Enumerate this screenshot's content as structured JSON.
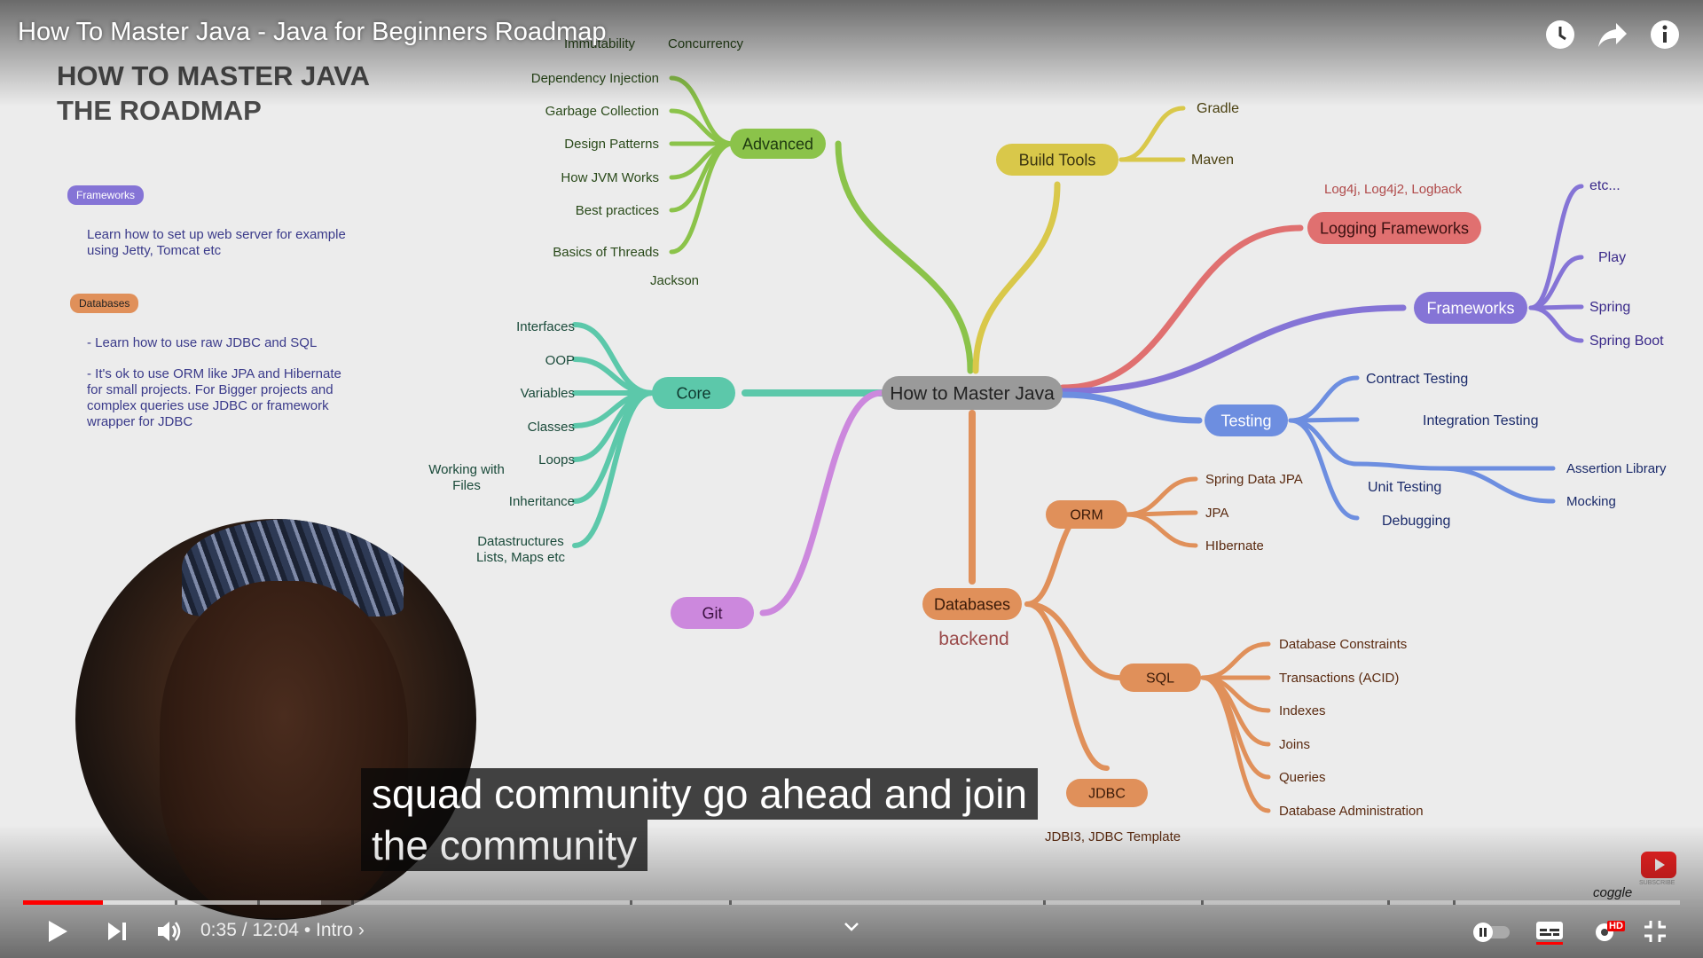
{
  "video": {
    "title": "How To Master Java - Java for Beginners Roadmap",
    "time_current": "0:35",
    "time_separator": "/",
    "time_total": "12:04",
    "chapter": "• Intro ›",
    "progress_played": 0.048,
    "progress_loaded": 0.18,
    "captions": [
      "squad community go ahead and join",
      "the community"
    ],
    "watermark": "coggle",
    "subscribe_label": "SUBSCRIBE"
  },
  "top_controls": {
    "watch_later_icon": "clock-icon",
    "share_icon": "share-icon",
    "info_icon": "info-icon"
  },
  "slide": {
    "heading_line1": "HOW TO MASTER JAVA",
    "heading_line2": "THE ROADMAP",
    "badge_frameworks": "Frameworks",
    "note_frameworks": [
      "Learn how to set up web server for example",
      "using Jetty, Tomcat etc"
    ],
    "badge_databases": "Databases",
    "note_db_1": "- Learn how to use raw JDBC and SQL",
    "note_db_2": [
      "- It's ok to use ORM like JPA and Hibernate",
      "for small projects. For Bigger projects and",
      "complex queries use JDBC or framework",
      "wrapper for JDBC"
    ]
  },
  "mindmap": {
    "center": "How to Master Java",
    "advanced": {
      "label": "Advanced",
      "items": [
        "Dependency Injection",
        "Garbage Collection",
        "Design Patterns",
        "How JVM Works",
        "Best practices",
        "Basics of Threads"
      ],
      "extra": [
        "Immutability",
        "Concurrency",
        "Jackson"
      ]
    },
    "build_tools": {
      "label": "Build Tools",
      "items": [
        "Gradle",
        "Maven"
      ]
    },
    "logging": {
      "label": "Logging Frameworks",
      "note": "Log4j, Log4j2, Logback"
    },
    "frameworks": {
      "label": "Frameworks",
      "items": [
        "etc...",
        "Play",
        "Spring",
        "Spring Boot"
      ]
    },
    "testing": {
      "label": "Testing",
      "items": [
        "Contract Testing",
        "Integration Testing",
        "Unit Testing",
        "Debugging"
      ],
      "unit_items": [
        "Assertion Library",
        "Mocking"
      ]
    },
    "core": {
      "label": "Core",
      "items": [
        "Interfaces",
        "OOP",
        "Variables",
        "Classes",
        "Loops",
        "Inheritance"
      ],
      "files": [
        "Working with",
        "Files"
      ],
      "ds": [
        "Datastructures",
        "Lists, Maps etc"
      ]
    },
    "git": {
      "label": "Git"
    },
    "databases": {
      "label": "Databases",
      "note": "backend"
    },
    "orm": {
      "label": "ORM",
      "items": [
        "Spring Data JPA",
        "JPA",
        "HIbernate"
      ]
    },
    "sql": {
      "label": "SQL",
      "items": [
        "Database Constraints",
        "Transactions (ACID)",
        "Indexes",
        "Joins",
        "Queries",
        "Database Administration"
      ]
    },
    "jdbc": {
      "label": "JDBC",
      "note": "JDBI3, JDBC Template"
    },
    "colors": {
      "advanced": "#8bc34a",
      "build": "#d9c84a",
      "logging": "#e07070",
      "frameworks": "#8574d6",
      "testing": "#6d8ee0",
      "core": "#5cc8aa",
      "git": "#cc88dd",
      "databases": "#e0905a",
      "center": "#9a9a9a"
    }
  },
  "player_controls": {
    "play_icon": "play-icon",
    "next_icon": "next-icon",
    "volume_icon": "volume-icon",
    "chevron_icon": "chevron-down-icon",
    "autoplay_icon": "autoplay-toggle-icon",
    "subtitles_icon": "subtitles-icon",
    "settings_icon": "gear-icon",
    "hd_badge": "HD",
    "exit_fullscreen_icon": "exit-fullscreen-icon"
  }
}
